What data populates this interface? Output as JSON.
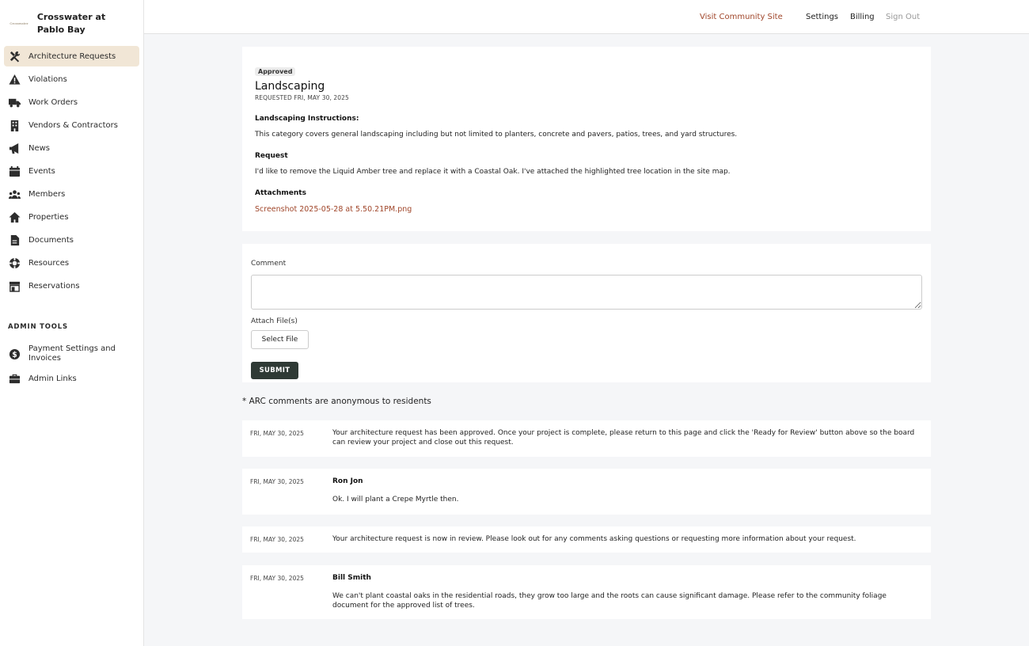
{
  "brand": {
    "name": "Crosswater at Pablo Bay",
    "logo_text": "Crosswater"
  },
  "sidebar": {
    "items": [
      {
        "label": "Architecture Requests",
        "icon": "tools-icon"
      },
      {
        "label": "Violations",
        "icon": "warning-icon"
      },
      {
        "label": "Work Orders",
        "icon": "truck-icon"
      },
      {
        "label": "Vendors & Contractors",
        "icon": "building-icon"
      },
      {
        "label": "News",
        "icon": "megaphone-icon"
      },
      {
        "label": "Events",
        "icon": "calendar-icon"
      },
      {
        "label": "Members",
        "icon": "users-icon"
      },
      {
        "label": "Properties",
        "icon": "house-icon"
      },
      {
        "label": "Documents",
        "icon": "document-icon"
      },
      {
        "label": "Resources",
        "icon": "lifebuoy-icon"
      },
      {
        "label": "Reservations",
        "icon": "store-icon"
      }
    ],
    "admin_heading": "ADMIN TOOLS",
    "admin_items": [
      {
        "label": "Payment Settings and Invoices",
        "icon": "dollar-circle-icon"
      },
      {
        "label": "Admin Links",
        "icon": "briefcase-icon"
      }
    ]
  },
  "topbar": {
    "visit": "Visit Community Site",
    "settings": "Settings",
    "billing": "Billing",
    "signout": "Sign Out"
  },
  "request": {
    "status": "Approved",
    "title": "Landscaping",
    "requested": "REQUESTED FRI, MAY 30, 2025",
    "instructions_heading": "Landscaping Instructions:",
    "instructions_text": "This category covers general landscaping including but not limited to planters, concrete and pavers, patios, trees, and yard structures.",
    "request_heading": "Request",
    "request_text": "I'd like to remove the Liquid Amber tree and replace it with a Coastal Oak. I've attached the highlighted tree location in the site map.",
    "attachments_heading": "Attachments",
    "attachment_name": "Screenshot 2025-05-28 at 5.50.21PM.png"
  },
  "form": {
    "comment_label": "Comment",
    "comment_value": "",
    "attach_label": "Attach File(s)",
    "select_file": "Select File",
    "submit": "SUBMIT"
  },
  "note": "* ARC comments are anonymous to residents",
  "comments": [
    {
      "date": "FRI, MAY 30, 2025",
      "author": "",
      "text": "Your architecture request has been approved. Once your project is complete, please return to this page and click the 'Ready for Review' button above so the board can review your project and close out this request."
    },
    {
      "date": "FRI, MAY 30, 2025",
      "author": "Ron Jon",
      "text": "Ok. I will plant a Crepe Myrtle then."
    },
    {
      "date": "FRI, MAY 30, 2025",
      "author": "",
      "text": "Your architecture request is now in review. Please look out for any comments asking questions or requesting more information about your request."
    },
    {
      "date": "FRI, MAY 30, 2025",
      "author": "Bill Smith",
      "text": "We can't plant coastal oaks in the residential roads, they grow too large and the roots can cause significant damage. Please refer to the community foliage document for the approved list of trees."
    }
  ]
}
